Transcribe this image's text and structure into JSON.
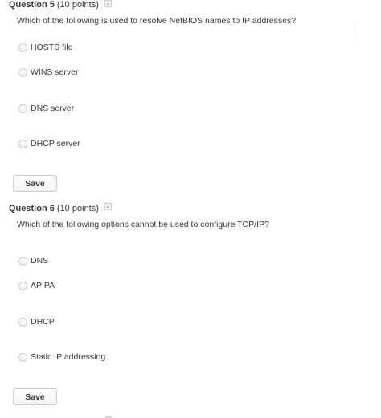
{
  "questions": [
    {
      "number": "Question 5",
      "points": "(10 points)",
      "text": "Which of the following is used to resolve NetBIOS names to IP addresses?",
      "answers": [
        "HOSTS file",
        "WINS server",
        "DNS server",
        "DHCP server"
      ],
      "save_label": "Save"
    },
    {
      "number": "Question 6",
      "points": "(10 points)",
      "text": "Which of the following options cannot be used to configure TCP/IP?",
      "answers": [
        "DNS",
        "APIPA",
        "DHCP",
        "Static IP addressing"
      ],
      "save_label": "Save"
    }
  ],
  "icons": {
    "flag": "flag-question-icon",
    "radio": "radio-unselected-icon"
  },
  "colors": {
    "text": "#2d3b45",
    "border": "#c7cdd1",
    "background": "#ffffff"
  }
}
